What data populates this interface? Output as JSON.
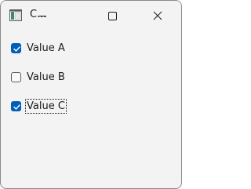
{
  "window": {
    "title": "C...",
    "app_icon": "app-window-icon",
    "controls": {
      "minimize": "minimize-icon",
      "maximize": "maximize-icon",
      "close": "close-icon"
    }
  },
  "checkboxes": [
    {
      "label": "Value A",
      "checked": true,
      "focused": false
    },
    {
      "label": "Value B",
      "checked": false,
      "focused": false
    },
    {
      "label": "Value C",
      "checked": true,
      "focused": true
    }
  ],
  "colors": {
    "accent": "#005fb8",
    "window_bg": "#f3f3f3",
    "text": "#1a1a1a"
  }
}
